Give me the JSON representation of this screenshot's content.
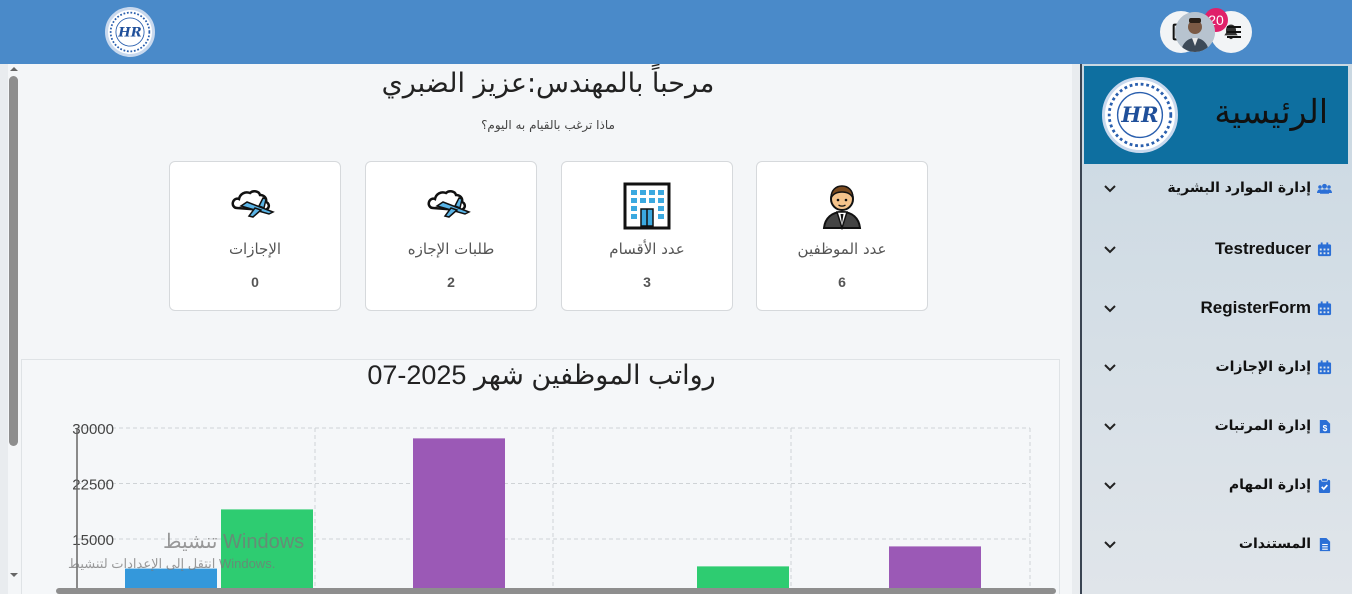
{
  "topbar": {
    "logo_alt": "HR",
    "notification_count": "20",
    "icons": [
      "logout-icon",
      "bell-icon",
      "menu-icon"
    ]
  },
  "welcome": {
    "title": "مرحباً بالمهندس:عزيز الضبري",
    "subtitle": "ماذا ترغب بالقيام به اليوم؟"
  },
  "cards": [
    {
      "label": "الإجازات",
      "count": "0",
      "icon": "airplane-icon"
    },
    {
      "label": "طلبات الإجازه",
      "count": "2",
      "icon": "airplane-icon"
    },
    {
      "label": "عدد الأقسام",
      "count": "3",
      "icon": "building-icon"
    },
    {
      "label": "عدد الموظفين",
      "count": "6",
      "icon": "employee-icon"
    }
  ],
  "chart_data": {
    "type": "bar",
    "title": "رواتب الموظفين شهر 2025-07",
    "xlabel": "",
    "ylabel": "",
    "ylim": [
      0,
      30000
    ],
    "yticks": [
      "30000",
      "22500",
      "15000"
    ],
    "grid": true,
    "series": [
      {
        "color": "#3498db",
        "values": [
          11000,
          null,
          null,
          null
        ]
      },
      {
        "color": "#2ecc71",
        "values": [
          19000,
          null,
          11300,
          null
        ]
      },
      {
        "color": "#9b59b6",
        "values": [
          null,
          28600,
          null,
          14000
        ]
      }
    ]
  },
  "watermark": {
    "line1": "تنشيط Windows",
    "line2": "انتقل إلى الإعدادات لتنشيط Windows."
  },
  "sidebar": {
    "title": "الرئيسية",
    "items": [
      {
        "label": "إدارة الموارد البشرية",
        "icon": "users-icon",
        "en": false
      },
      {
        "label": "Testreducer",
        "icon": "calendar-icon",
        "en": true
      },
      {
        "label": "RegisterForm",
        "icon": "calendar-icon",
        "en": true
      },
      {
        "label": "إدارة الإجازات",
        "icon": "calendar-icon",
        "en": false
      },
      {
        "label": "إدارة المرتبات",
        "icon": "money-file-icon",
        "en": false
      },
      {
        "label": "إدارة المهام",
        "icon": "clipboard-check-icon",
        "en": false
      },
      {
        "label": "المستندات",
        "icon": "document-icon",
        "en": false
      }
    ]
  },
  "colors": {
    "topbar": "#4a8ac9",
    "sidebar_header": "#0e6fa0",
    "badge": "#e0206a",
    "accent_icon": "#2b6fd6"
  }
}
